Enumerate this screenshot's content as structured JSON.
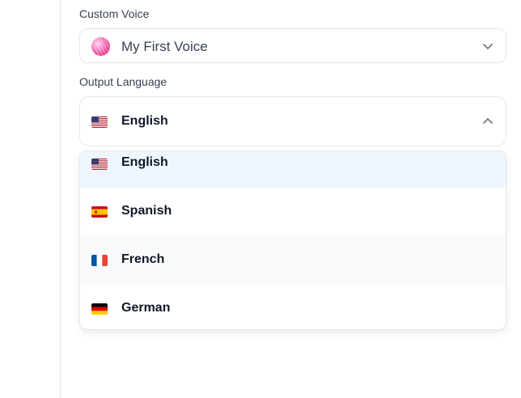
{
  "custom_voice": {
    "label": "Custom Voice",
    "selected": "My First Voice"
  },
  "output_language": {
    "label": "Output Language",
    "selected": "English",
    "selected_flag": "us-flag-icon"
  },
  "language_options": [
    {
      "label": "English",
      "flag": "us-flag-icon"
    },
    {
      "label": "Spanish",
      "flag": "spain-flag-icon"
    },
    {
      "label": "French",
      "flag": "france-flag-icon"
    },
    {
      "label": "German",
      "flag": "germany-flag-icon"
    }
  ],
  "colors": {
    "highlight": "#eff6ff",
    "border": "#e5e7eb",
    "avatar": "#f472b6"
  }
}
